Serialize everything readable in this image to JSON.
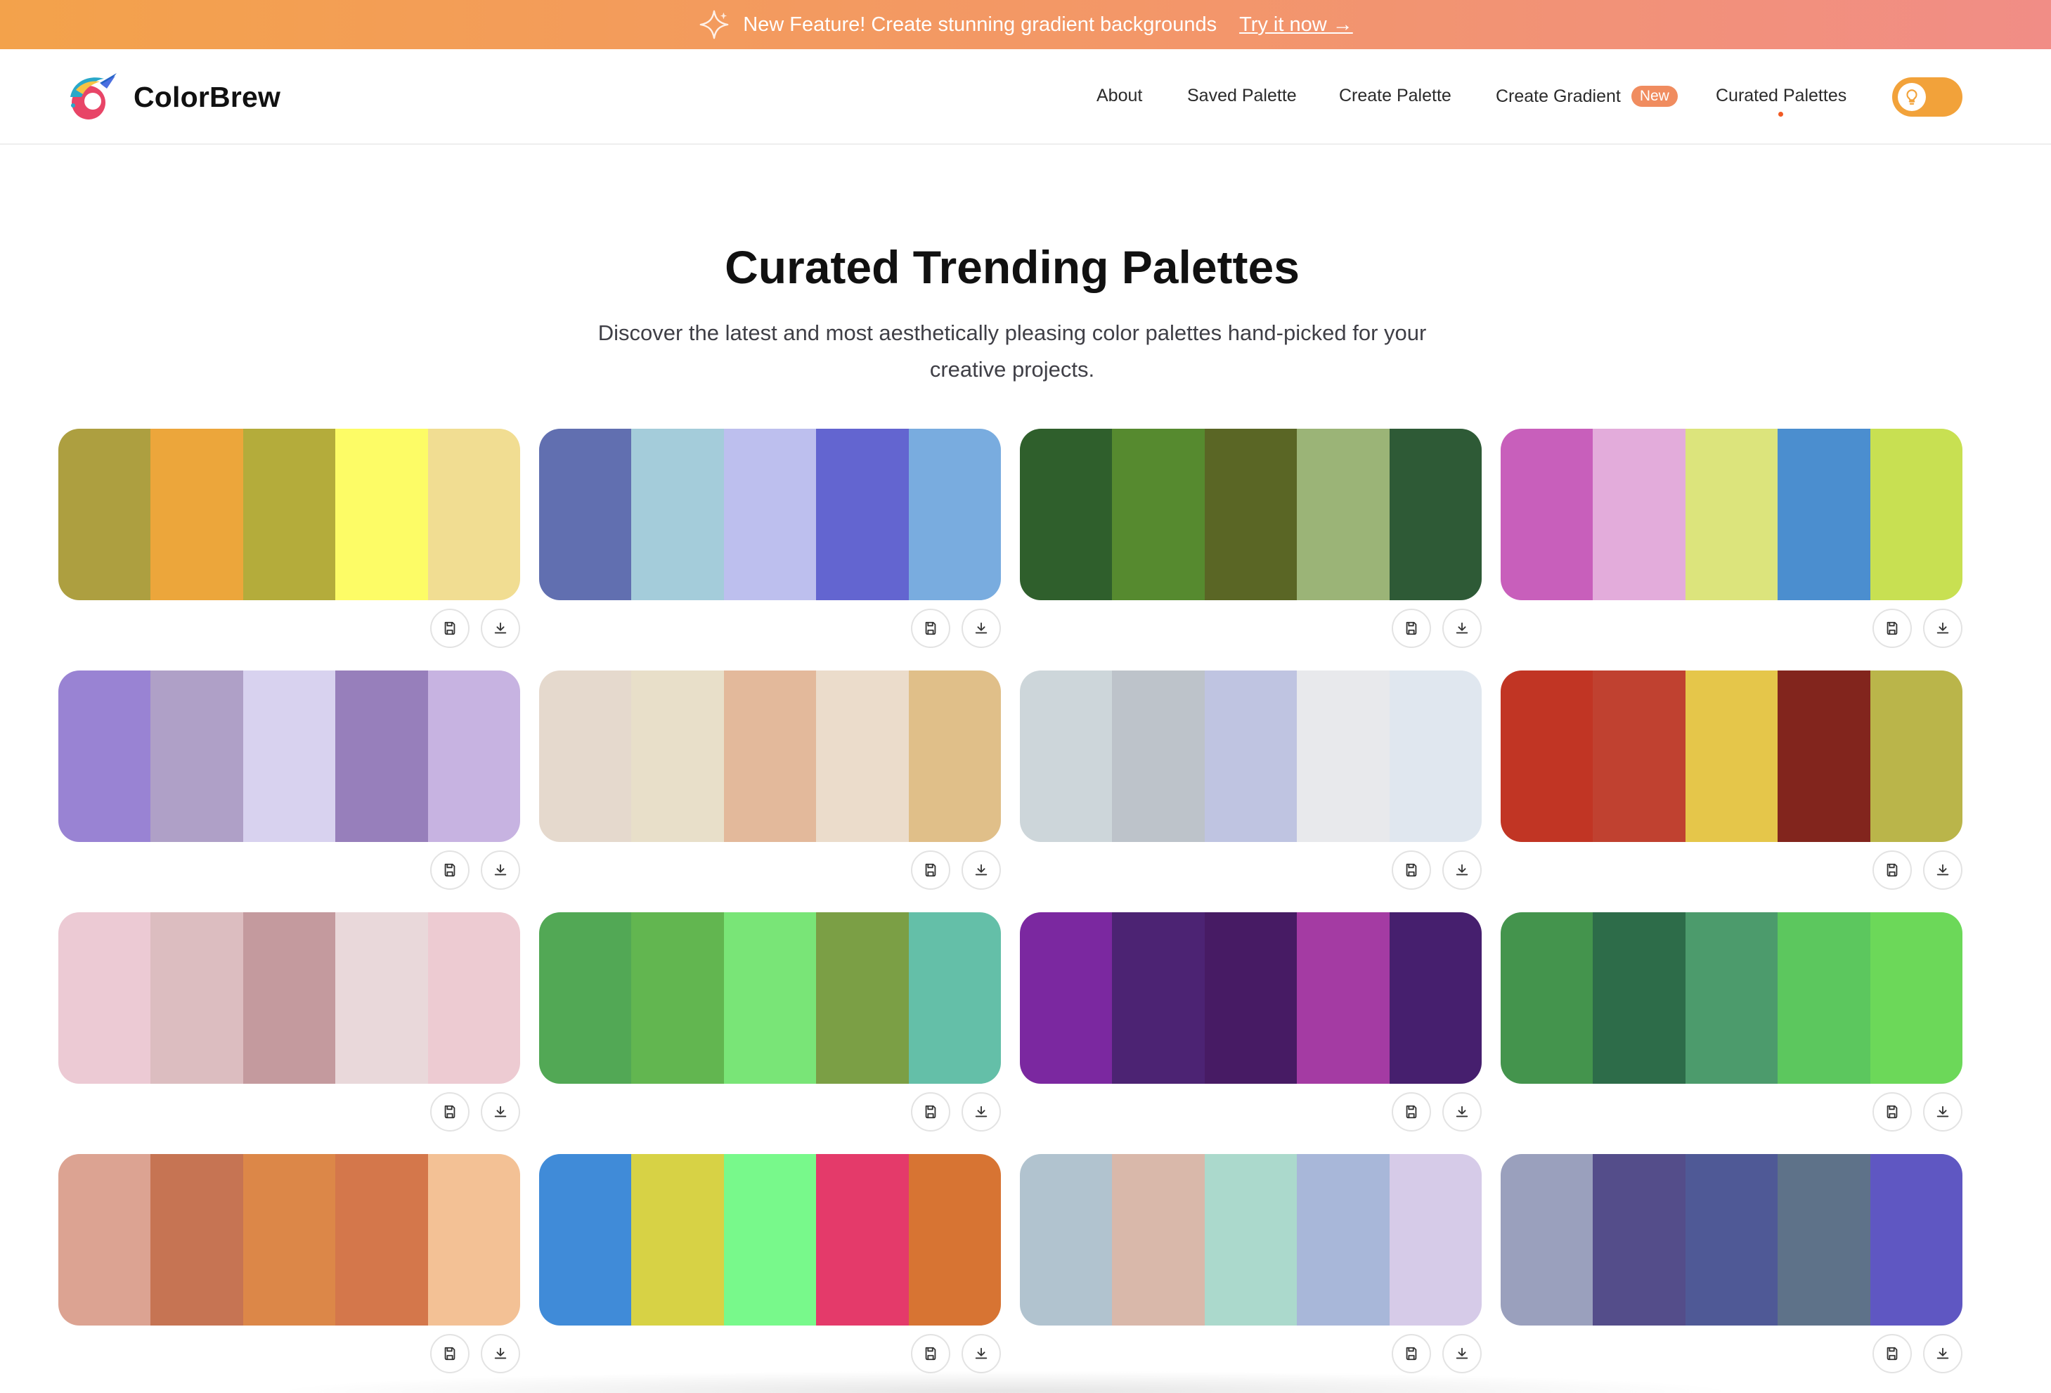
{
  "banner": {
    "text": "New Feature! Create stunning gradient backgrounds",
    "cta": "Try it now →",
    "icon": "sparkle-icon"
  },
  "brand": {
    "name": "ColorBrew",
    "logo_icon": "colorbrew-logo"
  },
  "nav": {
    "about": "About",
    "saved_palette": "Saved Palette",
    "create_palette": "Create Palette",
    "create_gradient": "Create Gradient",
    "new_badge": "New",
    "curated_palettes": "Curated Palettes",
    "active": "curated_palettes",
    "theme_toggle_icon": "lightbulb-icon"
  },
  "hero": {
    "title": "Curated Trending Palettes",
    "subtitle": "Discover the latest and most aesthetically pleasing color palettes hand-picked for your creative projects."
  },
  "actions": {
    "save_icon": "floppy-disk-icon",
    "download_icon": "download-icon"
  },
  "colors": {
    "accent": "#f2a23a",
    "active_dot": "#f15a24",
    "badge": "#f08c5f"
  },
  "palettes": [
    [
      "#ad9f40",
      "#eca63b",
      "#b4ac3b",
      "#fdfc66",
      "#f1dd92"
    ],
    [
      "#616fb0",
      "#a4ccda",
      "#bdbfee",
      "#6365d0",
      "#79acdf"
    ],
    [
      "#2f5f2c",
      "#568a2f",
      "#5a6625",
      "#9bb477",
      "#2e5a36"
    ],
    [
      "#c85fbb",
      "#e3acdb",
      "#dce47c",
      "#4b8ecf",
      "#c8e052"
    ],
    [
      "#9983d3",
      "#afa0c7",
      "#d8d2ef",
      "#977fbb",
      "#c7b3e1"
    ],
    [
      "#e5d9cd",
      "#e8dfc9",
      "#e3b99b",
      "#ebdccb",
      "#e0bf89"
    ],
    [
      "#cdd6da",
      "#bdc3ca",
      "#bfc4e1",
      "#e8e9ec",
      "#e0e7ef"
    ],
    [
      "#c13524",
      "#c04130",
      "#e5c64a",
      "#82251d",
      "#bab54a"
    ],
    [
      "#eccad4",
      "#dcbdc0",
      "#c49a9e",
      "#e9d8da",
      "#edcbd2"
    ],
    [
      "#52a855",
      "#62b650",
      "#79e577",
      "#7b9f45",
      "#64bfa8"
    ],
    [
      "#7b28a0",
      "#4c2373",
      "#471b64",
      "#a43ba3",
      "#461f6e"
    ],
    [
      "#44944d",
      "#2d6c49",
      "#4c9b6c",
      "#5cc75e",
      "#6cd859"
    ],
    [
      "#dca392",
      "#c67453",
      "#dc8748",
      "#d4774b",
      "#f3c195"
    ],
    [
      "#408bd8",
      "#d7d245",
      "#78f98b",
      "#e43a6a",
      "#d77433"
    ],
    [
      "#b1c3cf",
      "#d9b8aa",
      "#abd9cc",
      "#a8b7d9",
      "#d6cbe8"
    ],
    [
      "#9aa0bd",
      "#544d8a",
      "#4f5996",
      "#5e7289",
      "#5f57c2"
    ]
  ]
}
